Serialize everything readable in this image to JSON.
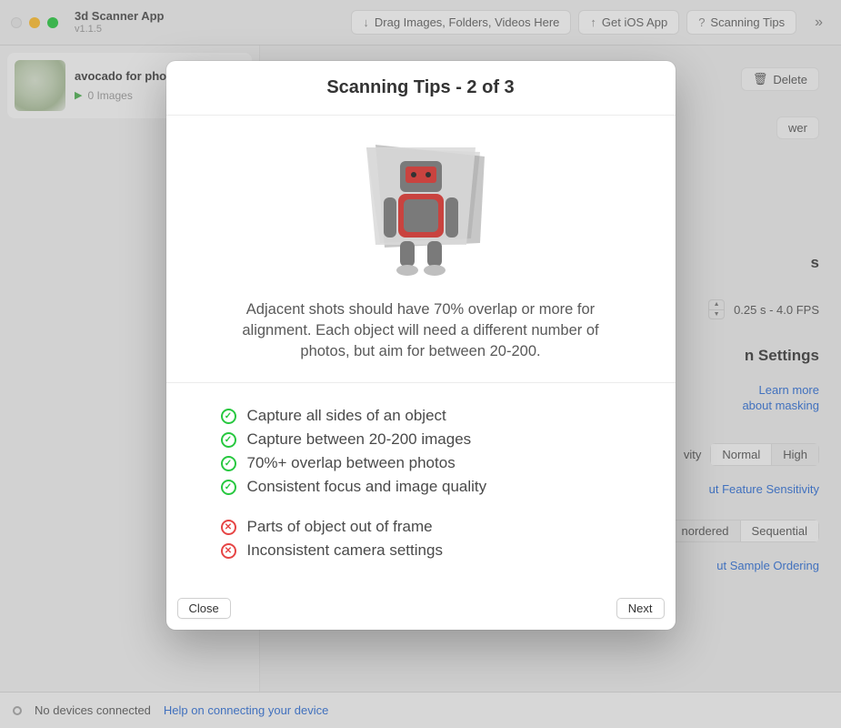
{
  "app": {
    "title": "3d Scanner App",
    "version": "v1.1.5"
  },
  "toolbar": {
    "drag": "Drag Images, Folders, Videos Here",
    "getios": "Get iOS App",
    "tips": "Scanning Tips"
  },
  "sidebar": {
    "project": {
      "name": "avocado for photogrammetry",
      "sub": "0 Images"
    }
  },
  "content": {
    "delete": "Delete",
    "partial_viewer": "wer",
    "partial_settings_s": "s",
    "stepper_label": "0.25 s - 4.0 FPS",
    "section2": "n Settings",
    "learn_more": "Learn more",
    "about_masking": "about masking",
    "sens_partial": "vity",
    "normal": "Normal",
    "high": "High",
    "link_sens": "ut Feature Sensitivity",
    "unordered": "nordered",
    "sequential": "Sequential",
    "link_ordering": "ut Sample Ordering"
  },
  "status": {
    "no_devices": "No devices connected",
    "help_link": "Help on connecting your device"
  },
  "modal": {
    "title": "Scanning Tips - 2 of 3",
    "desc": "Adjacent shots should have 70% overlap or more for alignment.  Each object will need a different number of photos, but aim for between 20-200.",
    "good": [
      "Capture all sides of an object",
      "Capture between 20-200 images",
      "70%+ overlap between photos",
      "Consistent focus and image quality"
    ],
    "bad": [
      "Parts of object out of frame",
      "Inconsistent camera settings"
    ],
    "close": "Close",
    "next": "Next"
  }
}
